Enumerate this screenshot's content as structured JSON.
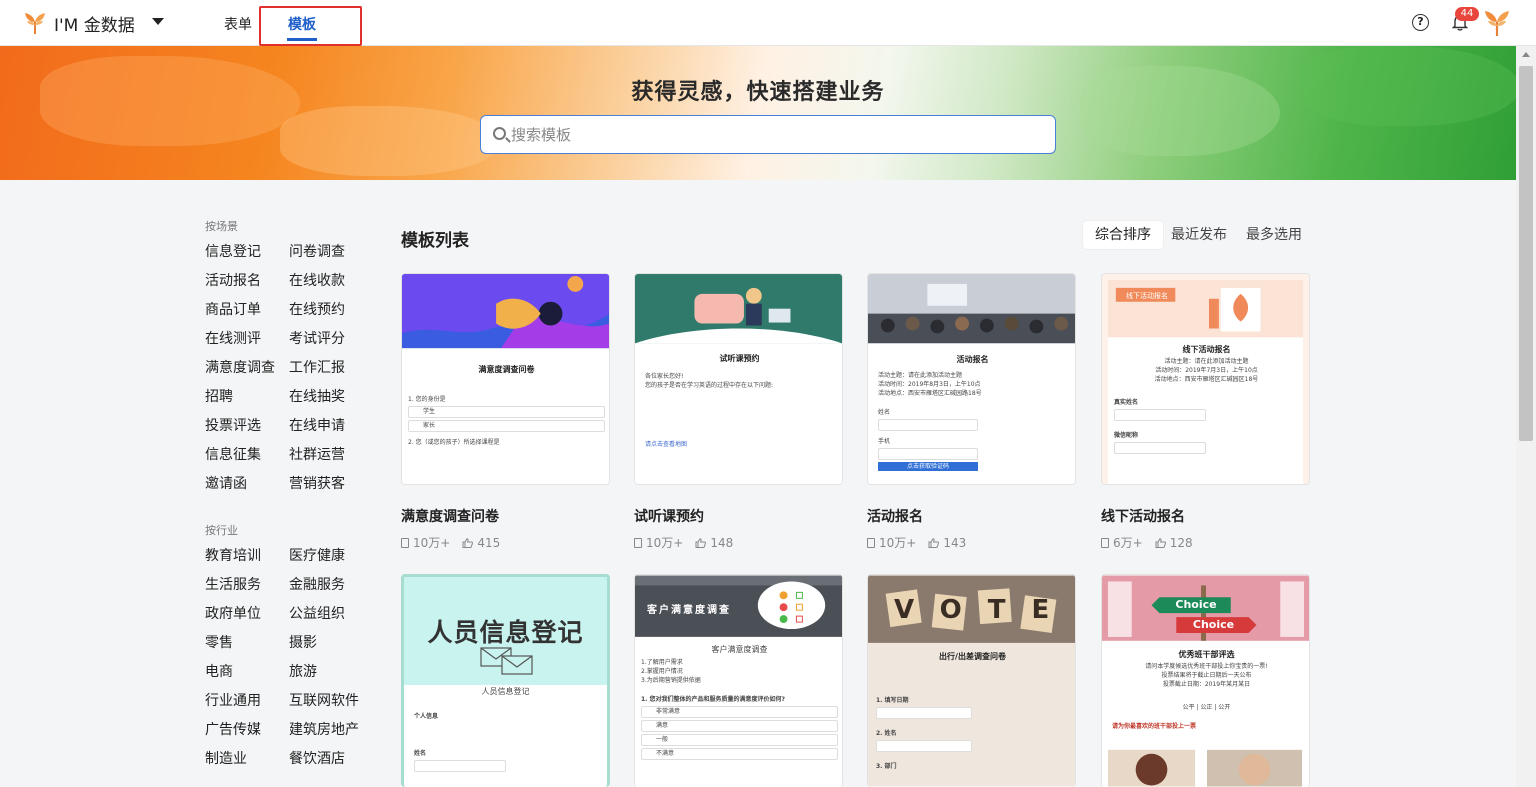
{
  "app": {
    "name": "I'M 金数据"
  },
  "nav": {
    "tabs": [
      {
        "label": "表单"
      },
      {
        "label": "模板"
      }
    ],
    "active": "模板"
  },
  "header": {
    "notification_count": "44"
  },
  "banner": {
    "title": "获得灵感，快速搭建业务"
  },
  "search": {
    "placeholder": "搜索模板"
  },
  "sidebar": {
    "scene_heading": "按场景",
    "scenes": [
      "信息登记",
      "问卷调查",
      "活动报名",
      "在线收款",
      "商品订单",
      "在线预约",
      "在线测评",
      "考试评分",
      "满意度调查",
      "工作汇报",
      "招聘",
      "在线抽奖",
      "投票评选",
      "在线申请",
      "信息征集",
      "社群运营",
      "邀请函",
      "营销获客"
    ],
    "industry_heading": "按行业",
    "industries": [
      "教育培训",
      "医疗健康",
      "生活服务",
      "金融服务",
      "政府单位",
      "公益组织",
      "零售",
      "摄影",
      "电商",
      "旅游",
      "行业通用",
      "互联网软件",
      "广告传媒",
      "建筑房地产",
      "制造业",
      "餐饮酒店"
    ]
  },
  "main": {
    "title": "模板列表",
    "sort_options": [
      "综合排序",
      "最近发布",
      "最多选用"
    ],
    "active_sort": "综合排序",
    "templates": [
      {
        "title": "满意度调查问卷",
        "uses": "10万+",
        "likes": "415"
      },
      {
        "title": "试听课预约",
        "uses": "10万+",
        "likes": "148"
      },
      {
        "title": "活动报名",
        "uses": "10万+",
        "likes": "143"
      },
      {
        "title": "线下活动报名",
        "uses": "6万+",
        "likes": "128"
      },
      {
        "title": "人员信息登记"
      },
      {
        "title": "客户满意度调查"
      },
      {
        "title": "出行/出差调查问卷"
      },
      {
        "title": "优秀班干部评选"
      }
    ]
  },
  "thumbs": {
    "t1": {
      "heading": "满意度调查问卷",
      "q1": "1. 您的身份是",
      "o1": "学生",
      "o2": "家长",
      "q2": "2. 您（或您的孩子）所选择课程是"
    },
    "t2": {
      "heading": "试听课预约",
      "line1": "各位家长您好!",
      "line2": "您的孩子是否在学习英语的过程中存在以下问题:",
      "btn": "请点击查看地图"
    },
    "t3": {
      "heading": "活动报名",
      "l1": "活动主题：请在此添加活动主题",
      "l2": "活动时间：2019年8月3日，上午10点",
      "l3": "活动地点：西安市雁塔区汇碱园路18号",
      "f1": "姓名",
      "f2": "手机",
      "btn": "点击获取验证码"
    },
    "t4": {
      "tag": "线下活动报名",
      "heading": "线下活动报名",
      "l1": "活动主题：请在此添加活动主题",
      "l2": "活动时间：2019年7月3日，上午10点",
      "l3": "活动地点：西安市雁塔区汇碱园区18号",
      "f1": "真实姓名",
      "f2": "微信昵称"
    },
    "t5": {
      "big": "人员信息登记",
      "small": "人员信息登记",
      "sec": "个人信息",
      "f1": "姓名"
    },
    "t6": {
      "banner": "客户满意度调查",
      "heading": "客户满意度调查",
      "l1": "1.了解用户需求",
      "l2": "2.掌握用户情况",
      "l3": "3.为后期营销提供依据",
      "q": "1. 您对我们整体的产品和服务质量的满意度评价如何?",
      "o1": "非常满意",
      "o2": "满意",
      "o3": "一般",
      "o4": "不满意"
    },
    "t7": {
      "vote": "VOTE",
      "heading": "出行/出差调查问卷",
      "f1": "1. 填写日期",
      "f2": "2. 姓名",
      "f3": "3. 部门"
    },
    "t8": {
      "sign1": "Choice",
      "sign2": "Choice",
      "heading": "优秀班干部评选",
      "l1": "请问本学度候选优秀班干部投上你宝贵的一票!",
      "l2": "投票结果将于截止日期后一天公布",
      "l3": "投票截止日期：2019年某月某日",
      "motto": "公平 | 公正 | 公开",
      "q": "请为你最喜欢的班干部投上一票"
    }
  }
}
